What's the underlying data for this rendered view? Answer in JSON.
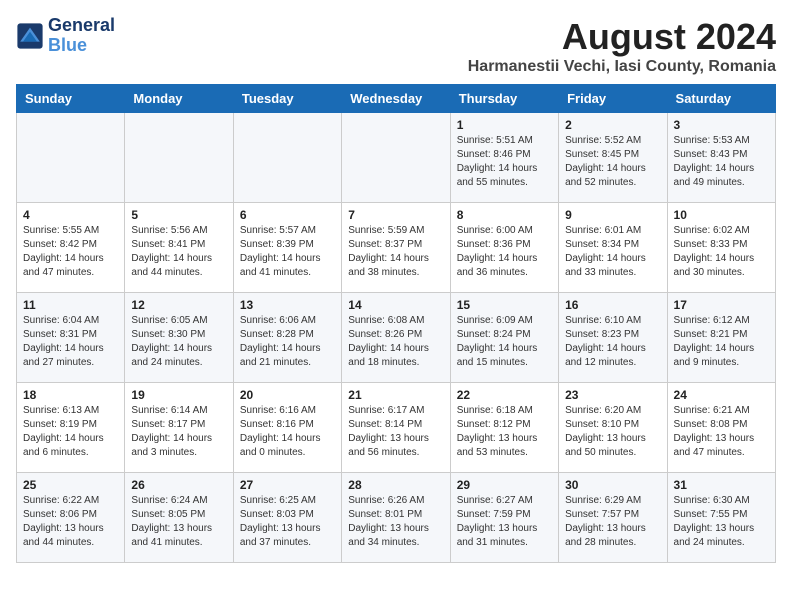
{
  "header": {
    "logo_line1": "General",
    "logo_line2": "Blue",
    "title": "August 2024",
    "subtitle": "Harmanestii Vechi, Iasi County, Romania"
  },
  "days_of_week": [
    "Sunday",
    "Monday",
    "Tuesday",
    "Wednesday",
    "Thursday",
    "Friday",
    "Saturday"
  ],
  "weeks": [
    [
      {
        "day": "",
        "info": ""
      },
      {
        "day": "",
        "info": ""
      },
      {
        "day": "",
        "info": ""
      },
      {
        "day": "",
        "info": ""
      },
      {
        "day": "1",
        "info": "Sunrise: 5:51 AM\nSunset: 8:46 PM\nDaylight: 14 hours\nand 55 minutes."
      },
      {
        "day": "2",
        "info": "Sunrise: 5:52 AM\nSunset: 8:45 PM\nDaylight: 14 hours\nand 52 minutes."
      },
      {
        "day": "3",
        "info": "Sunrise: 5:53 AM\nSunset: 8:43 PM\nDaylight: 14 hours\nand 49 minutes."
      }
    ],
    [
      {
        "day": "4",
        "info": "Sunrise: 5:55 AM\nSunset: 8:42 PM\nDaylight: 14 hours\nand 47 minutes."
      },
      {
        "day": "5",
        "info": "Sunrise: 5:56 AM\nSunset: 8:41 PM\nDaylight: 14 hours\nand 44 minutes."
      },
      {
        "day": "6",
        "info": "Sunrise: 5:57 AM\nSunset: 8:39 PM\nDaylight: 14 hours\nand 41 minutes."
      },
      {
        "day": "7",
        "info": "Sunrise: 5:59 AM\nSunset: 8:37 PM\nDaylight: 14 hours\nand 38 minutes."
      },
      {
        "day": "8",
        "info": "Sunrise: 6:00 AM\nSunset: 8:36 PM\nDaylight: 14 hours\nand 36 minutes."
      },
      {
        "day": "9",
        "info": "Sunrise: 6:01 AM\nSunset: 8:34 PM\nDaylight: 14 hours\nand 33 minutes."
      },
      {
        "day": "10",
        "info": "Sunrise: 6:02 AM\nSunset: 8:33 PM\nDaylight: 14 hours\nand 30 minutes."
      }
    ],
    [
      {
        "day": "11",
        "info": "Sunrise: 6:04 AM\nSunset: 8:31 PM\nDaylight: 14 hours\nand 27 minutes."
      },
      {
        "day": "12",
        "info": "Sunrise: 6:05 AM\nSunset: 8:30 PM\nDaylight: 14 hours\nand 24 minutes."
      },
      {
        "day": "13",
        "info": "Sunrise: 6:06 AM\nSunset: 8:28 PM\nDaylight: 14 hours\nand 21 minutes."
      },
      {
        "day": "14",
        "info": "Sunrise: 6:08 AM\nSunset: 8:26 PM\nDaylight: 14 hours\nand 18 minutes."
      },
      {
        "day": "15",
        "info": "Sunrise: 6:09 AM\nSunset: 8:24 PM\nDaylight: 14 hours\nand 15 minutes."
      },
      {
        "day": "16",
        "info": "Sunrise: 6:10 AM\nSunset: 8:23 PM\nDaylight: 14 hours\nand 12 minutes."
      },
      {
        "day": "17",
        "info": "Sunrise: 6:12 AM\nSunset: 8:21 PM\nDaylight: 14 hours\nand 9 minutes."
      }
    ],
    [
      {
        "day": "18",
        "info": "Sunrise: 6:13 AM\nSunset: 8:19 PM\nDaylight: 14 hours\nand 6 minutes."
      },
      {
        "day": "19",
        "info": "Sunrise: 6:14 AM\nSunset: 8:17 PM\nDaylight: 14 hours\nand 3 minutes."
      },
      {
        "day": "20",
        "info": "Sunrise: 6:16 AM\nSunset: 8:16 PM\nDaylight: 14 hours and 0 minutes."
      },
      {
        "day": "21",
        "info": "Sunrise: 6:17 AM\nSunset: 8:14 PM\nDaylight: 13 hours\nand 56 minutes."
      },
      {
        "day": "22",
        "info": "Sunrise: 6:18 AM\nSunset: 8:12 PM\nDaylight: 13 hours\nand 53 minutes."
      },
      {
        "day": "23",
        "info": "Sunrise: 6:20 AM\nSunset: 8:10 PM\nDaylight: 13 hours\nand 50 minutes."
      },
      {
        "day": "24",
        "info": "Sunrise: 6:21 AM\nSunset: 8:08 PM\nDaylight: 13 hours\nand 47 minutes."
      }
    ],
    [
      {
        "day": "25",
        "info": "Sunrise: 6:22 AM\nSunset: 8:06 PM\nDaylight: 13 hours\nand 44 minutes."
      },
      {
        "day": "26",
        "info": "Sunrise: 6:24 AM\nSunset: 8:05 PM\nDaylight: 13 hours\nand 41 minutes."
      },
      {
        "day": "27",
        "info": "Sunrise: 6:25 AM\nSunset: 8:03 PM\nDaylight: 13 hours\nand 37 minutes."
      },
      {
        "day": "28",
        "info": "Sunrise: 6:26 AM\nSunset: 8:01 PM\nDaylight: 13 hours\nand 34 minutes."
      },
      {
        "day": "29",
        "info": "Sunrise: 6:27 AM\nSunset: 7:59 PM\nDaylight: 13 hours\nand 31 minutes."
      },
      {
        "day": "30",
        "info": "Sunrise: 6:29 AM\nSunset: 7:57 PM\nDaylight: 13 hours\nand 28 minutes."
      },
      {
        "day": "31",
        "info": "Sunrise: 6:30 AM\nSunset: 7:55 PM\nDaylight: 13 hours\nand 24 minutes."
      }
    ]
  ]
}
